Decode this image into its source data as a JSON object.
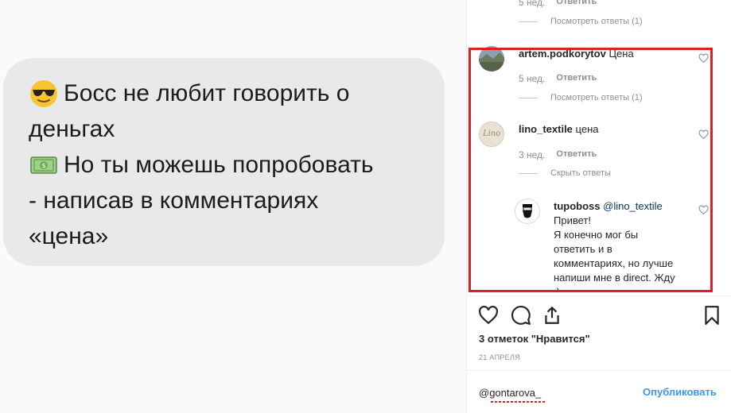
{
  "post_image": {
    "line1": "Босс не любит говорить о",
    "line2": "деньгах",
    "line3": "Но ты можешь попробовать",
    "line4": "- написав в комментариях",
    "line5": "«цена»"
  },
  "comments_top": {
    "meta_time": "5 нед.",
    "meta_reply": "Ответить",
    "view_replies": "Посмотреть ответы (1)"
  },
  "comments": [
    {
      "username": "artem.podkorytov",
      "text": "Цена",
      "time": "5 нед.",
      "reply": "Ответить",
      "replies_link": "Посмотреть ответы (1)"
    },
    {
      "username": "lino_textile",
      "text": "цена",
      "time": "3 нед.",
      "reply": "Ответить",
      "replies_link": "Скрыть ответы",
      "avatar_text": "Lino"
    }
  ],
  "reply": {
    "username": "tupoboss",
    "mention": "@lino_textile",
    "line1": "Привет!",
    "line2": "Я конечно мог бы",
    "line3": "ответить и в",
    "line4": "комментариях, но лучше",
    "line5": "напиши мне в direct. Жду",
    "line6": ":)"
  },
  "footer": {
    "likes": "3 отметок \"Нравится\"",
    "date": "21 АПРЕЛЯ",
    "comment_value": "@gontarova_",
    "publish": "Опубликовать"
  },
  "colors": {
    "highlight_border": "#e02020",
    "link_blue": "#3897f0",
    "bubble": "#e9e9eb"
  },
  "icons": [
    "sunglasses-emoji-icon",
    "money-emoji-icon",
    "heart-icon",
    "comment-icon",
    "share-icon",
    "bookmark-icon"
  ]
}
